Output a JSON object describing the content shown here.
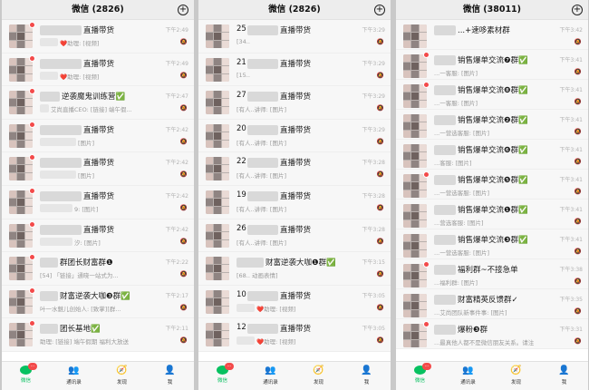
{
  "phones": [
    {
      "header_title": "微信 (2826)",
      "tabs": [
        {
          "label": "微信",
          "badge": "···"
        },
        {
          "label": "通讯录"
        },
        {
          "label": "发现"
        },
        {
          "label": "我"
        }
      ],
      "rows": [
        {
          "title": "直播带货",
          "sub": "❤️助理: [视频]",
          "time": "下午2:49"
        },
        {
          "title": "直播带货",
          "sub": "❤️助理: [视频]",
          "time": "下午2:49"
        },
        {
          "title": "逆袭魔鬼训练营✅",
          "sub": "艾尚直播CEO: [链接] 端午假...",
          "time": "下午2:47"
        },
        {
          "title": "直播带货",
          "sub": "[图片]",
          "time": "下午2:42"
        },
        {
          "title": "直播带货",
          "sub": "[图片]",
          "time": "下午2:42"
        },
        {
          "title": "直播带货",
          "sub": "9: [图片]",
          "time": "下午2:42"
        },
        {
          "title": "直播带货",
          "sub": "汐: [图片]",
          "time": "下午2:42"
        },
        {
          "title": "群团长财富群❶",
          "sub": "[54] 「链接」通晓一站式为...",
          "time": "下午2:22"
        },
        {
          "title": "财富逆袭大咖❸群✅",
          "sub": "叶一水魅儿创始人: [致掌][群...",
          "time": "下午2:17"
        },
        {
          "title": "团长基地✅",
          "sub": "助理: [链接] 端午假期 福利大放送",
          "time": "下午2:11"
        }
      ]
    },
    {
      "header_title": "微信 (2826)",
      "tabs": [
        {
          "label": "微信",
          "badge": "···"
        },
        {
          "label": "通讯录"
        },
        {
          "label": "发现"
        },
        {
          "label": "我"
        }
      ],
      "rows": [
        {
          "num": "25",
          "title": "直播带货",
          "sub": "[34..",
          "time": "下午3:29"
        },
        {
          "num": "21",
          "title": "直播带货",
          "sub": "[15..",
          "time": "下午3:29"
        },
        {
          "num": "27",
          "title": "直播带货",
          "sub": "[有人..讲师: [图片]",
          "time": "下午3:29"
        },
        {
          "num": "20",
          "title": "直播带货",
          "sub": "[有人..讲师: [图片]",
          "time": "下午3:29"
        },
        {
          "num": "22",
          "title": "直播带货",
          "sub": "[有人..讲师: [图片]",
          "time": "下午3:28"
        },
        {
          "num": "19",
          "title": "直播带货",
          "sub": "[有人..讲师: [图片]",
          "time": "下午3:28"
        },
        {
          "num": "26",
          "title": "直播带货",
          "sub": "[有人..讲师: [图片]",
          "time": "下午3:28"
        },
        {
          "num": "",
          "title": "财富逆袭大咖❶群✅",
          "sub": "[68.. 动画表情]",
          "time": "下午3:15"
        },
        {
          "num": "10",
          "title": "直播带货",
          "sub": "❤️助理: [视频]",
          "time": "下午3:05"
        },
        {
          "num": "12",
          "title": "直播带货",
          "sub": "❤️助理: [视频]",
          "time": "下午3:05"
        }
      ]
    },
    {
      "header_title": "微信 (38011)",
      "tabs": [
        {
          "label": "微信",
          "badge": "···"
        },
        {
          "label": "通讯录"
        },
        {
          "label": "发现"
        },
        {
          "label": "我"
        }
      ],
      "rows": [
        {
          "title": "...+速哆素材群",
          "sub": "",
          "time": "下午3:42"
        },
        {
          "title": "销售爆单交流❼群✅",
          "sub": "...一客服: [图片]",
          "time": "下午3:41"
        },
        {
          "title": "销售爆单交流❽群✅",
          "sub": "...一客服: [图片]",
          "time": "下午3:41"
        },
        {
          "title": "销售爆单交流❷群✅",
          "sub": "...一营选客服: [图片]",
          "time": "下午3:41"
        },
        {
          "title": "销售爆单交流❻群✅",
          "sub": "...客服: [图片]",
          "time": "下午3:41"
        },
        {
          "title": "销售爆单交流❺群✅",
          "sub": "...一营选客服: [图片]",
          "time": "下午3:41"
        },
        {
          "title": "销售爆单交流❶群✅",
          "sub": "...营选客服: [图片]",
          "time": "下午3:41"
        },
        {
          "title": "销售爆单交流❸群✅",
          "sub": "...一营选客服: [图片]",
          "time": "下午3:41"
        },
        {
          "title": "福利群~不接急单",
          "sub": "...福利群: [图片]",
          "time": "下午3:38"
        },
        {
          "title": "财富精英反馈群✓",
          "sub": "...艾尚团队新事件事: [图片]",
          "time": "下午3:35"
        },
        {
          "title": "爆粉❸群",
          "sub": "...最真他人都不是微信朋友关系。请注...",
          "time": "下午3:31"
        }
      ]
    }
  ]
}
